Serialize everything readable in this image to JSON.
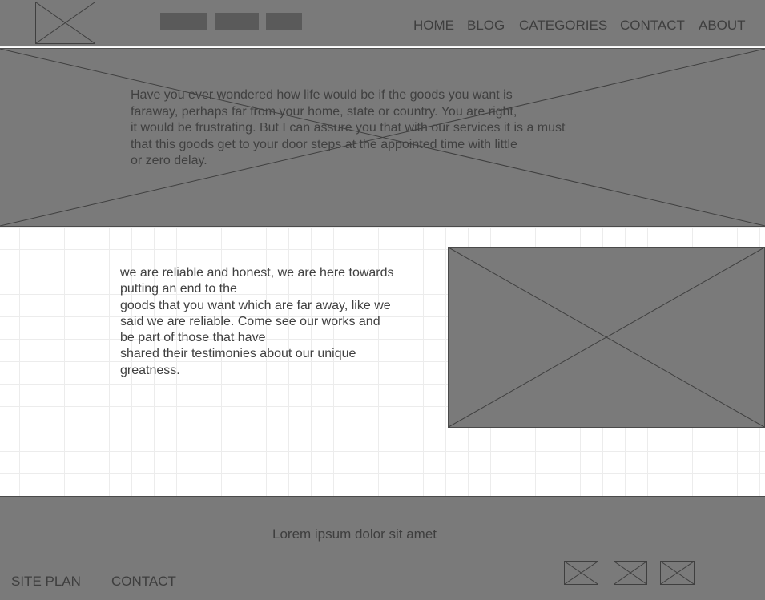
{
  "header": {
    "nav": [
      "HOME",
      "BLOG",
      "CATEGORIES",
      "CONTACT",
      "ABOUT"
    ]
  },
  "hero": {
    "lines": [
      "Have you ever wondered how life would be if the goods you want is",
      "faraway, perhaps far from your home, state or country. You are right,",
      "it would be frustrating. But I can assure you that with our services it is a must",
      "that this goods get to your door steps at the appointed time with little",
      "or zero delay."
    ]
  },
  "about": {
    "lines": [
      "we are reliable and honest, we are here towards",
      "putting an end to the",
      "goods that you want which are far away, like we",
      "said we are reliable. Come see our works and",
      "be part of those that have",
      "shared their testimonies about our unique",
      "greatness."
    ]
  },
  "footer": {
    "tagline": "Lorem ipsum dolor sit amet",
    "links": [
      "SITE PLAN",
      "CONTACT"
    ]
  },
  "colors": {
    "placeholder_fill": "#7a7a7a",
    "text": "#404040",
    "grid_line": "#ececec"
  }
}
